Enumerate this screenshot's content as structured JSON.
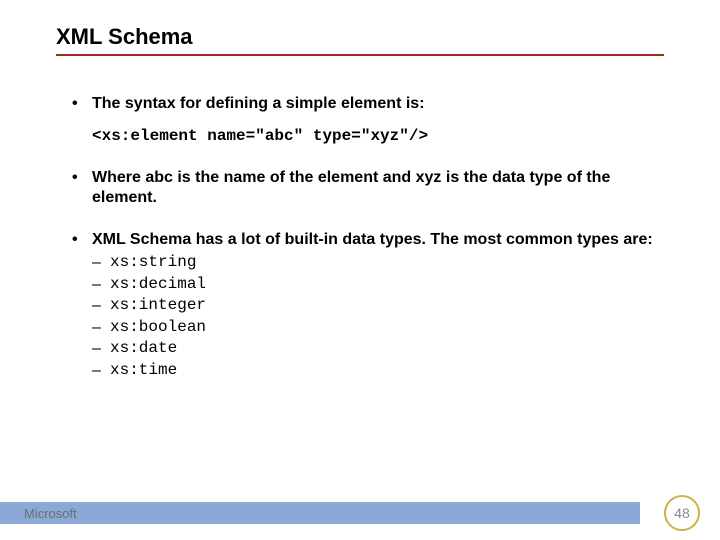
{
  "title": "XML Schema",
  "bullets": {
    "b1_text": "The syntax for defining a simple element is:",
    "code": "<xs:element name=\"abc\" type=\"xyz\"/>",
    "b2_text": "Where abc is the name of the element and xyz is the data type of the element.",
    "b3_text": "XML Schema has a lot of built-in data types. The most common types are:",
    "types": {
      "t0": "xs:string",
      "t1": "xs:decimal",
      "t2": "xs:integer",
      "t3": "xs:boolean",
      "t4": "xs:date",
      "t5": "xs:time"
    }
  },
  "footer": {
    "brand": "Microsoft",
    "page": "48"
  }
}
